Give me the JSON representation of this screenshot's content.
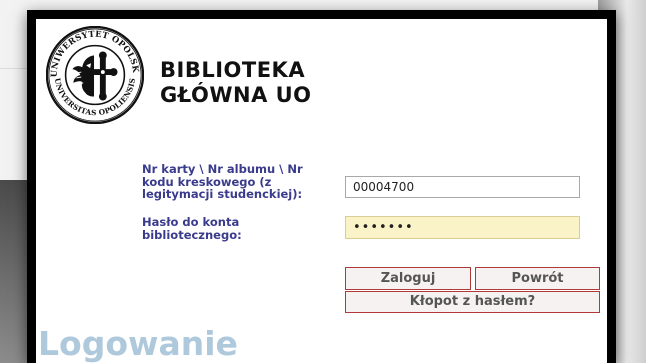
{
  "library": {
    "name_line1": "BIBLIOTEKA",
    "name_line2": "GŁÓWNA UO",
    "seal_text_top": "UNIWERSYTET OPOLSKI",
    "seal_text_bottom": "UNIVERSITAS OPOLIENSIS"
  },
  "form": {
    "login_label": "Nr karty \\ Nr albumu \\ Nr kodu kreskowego (z legitymacji studenckiej):",
    "login_value": "00004700",
    "password_label": "Hasło do konta bibliotecznego:",
    "password_value": "1234567"
  },
  "buttons": {
    "login": "Zaloguj",
    "back": "Powrót",
    "forgot": "Kłopot z hasłem?"
  },
  "page": {
    "heading": "Logowanie"
  },
  "colors": {
    "label_text": "#3a3b8c",
    "button_border": "#b03a3a",
    "password_bg": "#fbf3c8",
    "heading": "#aec8dc"
  }
}
